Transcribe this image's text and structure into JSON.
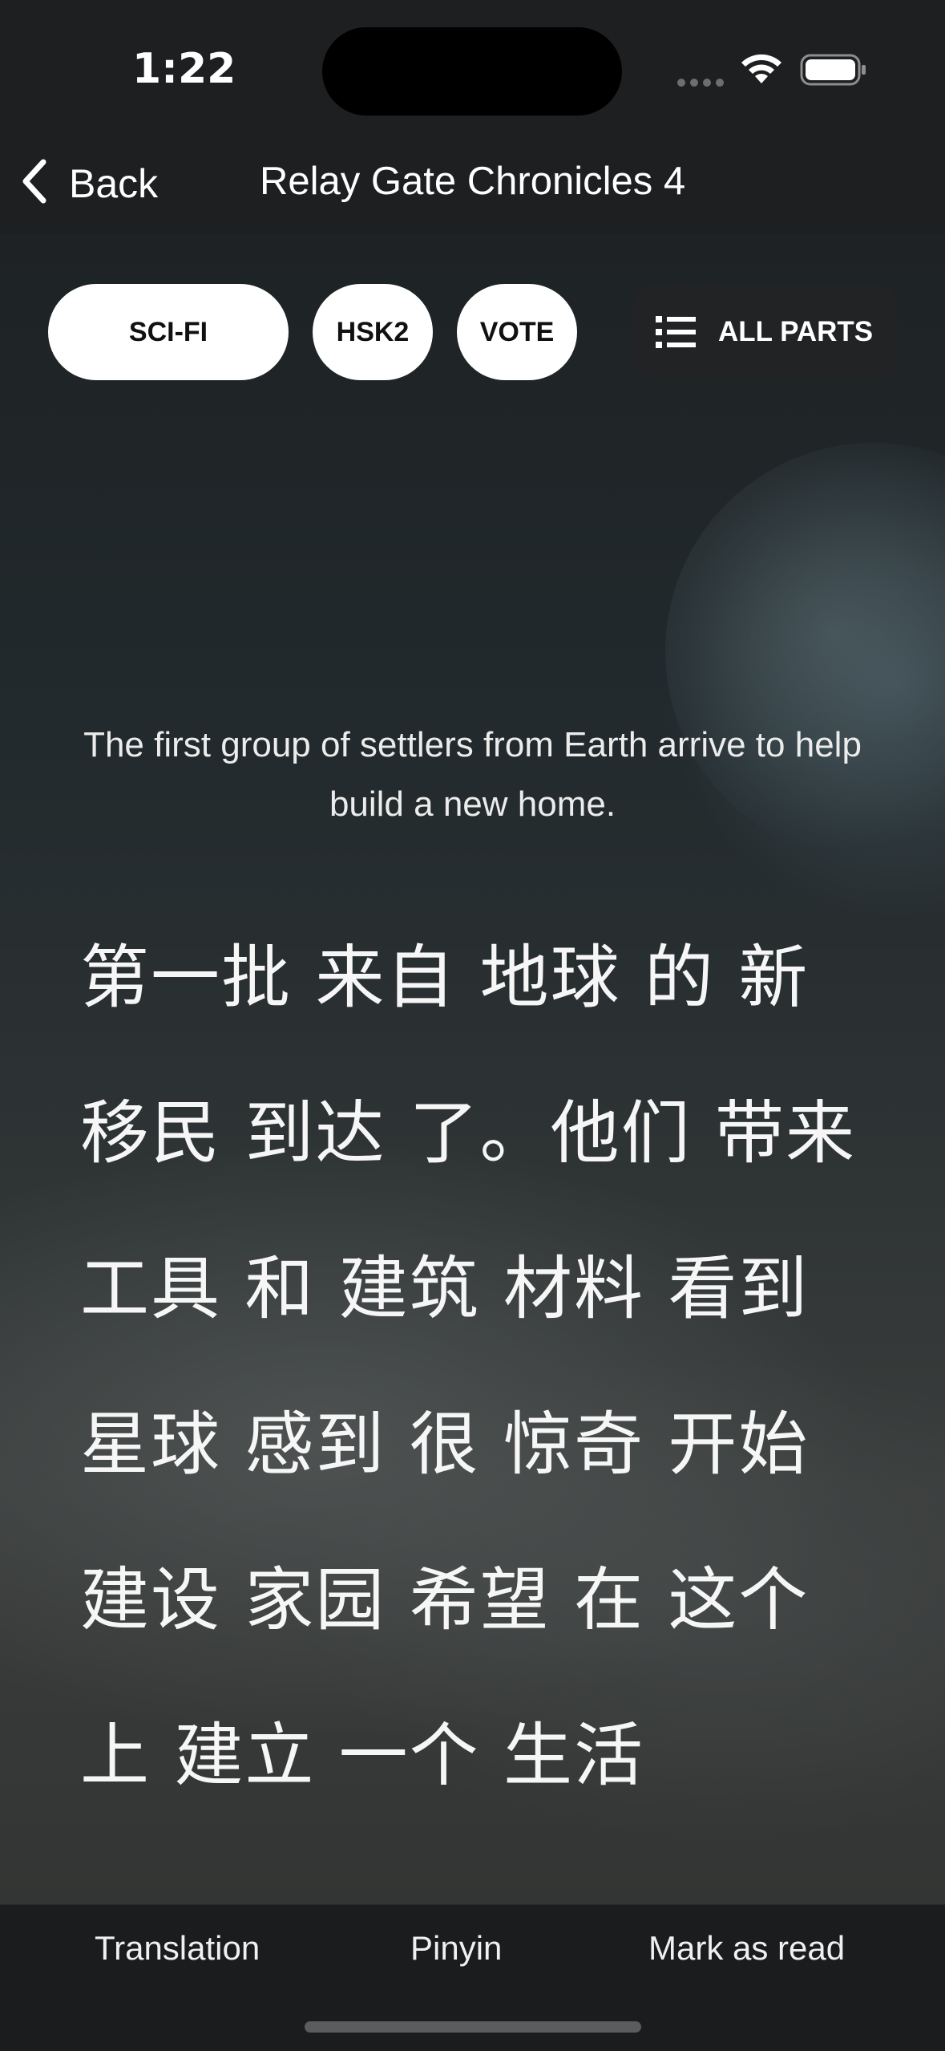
{
  "status_bar": {
    "time": "1:22"
  },
  "nav": {
    "back_label": "Back",
    "title": "Relay Gate Chronicles 4"
  },
  "tags": {
    "genre": "SCI-FI",
    "level": "HSK2",
    "vote": "VOTE",
    "all_parts": "ALL PARTS"
  },
  "summary": "The first group of settlers from Earth arrive to help build a new home.",
  "story_lines": [
    "第一批 来自 地球 的 新",
    "移民 到达 了。他们 带来",
    "工具 和 建筑 材料 看到",
    "星球 感到 很 惊奇 开始",
    "建设 家园 希望 在 这个",
    "上 建立 一个 生活"
  ],
  "bottom_bar": {
    "translation": "Translation",
    "pinyin": "Pinyin",
    "mark_read": "Mark as read"
  },
  "icons": {
    "back": "chevron-left-icon",
    "list": "list-icon",
    "wifi": "wifi-icon",
    "battery": "battery-icon",
    "signal": "cellular-signal-icon"
  },
  "colors": {
    "background": "#1c1d1f",
    "chip": "#ffffff",
    "text": "#ffffff"
  }
}
